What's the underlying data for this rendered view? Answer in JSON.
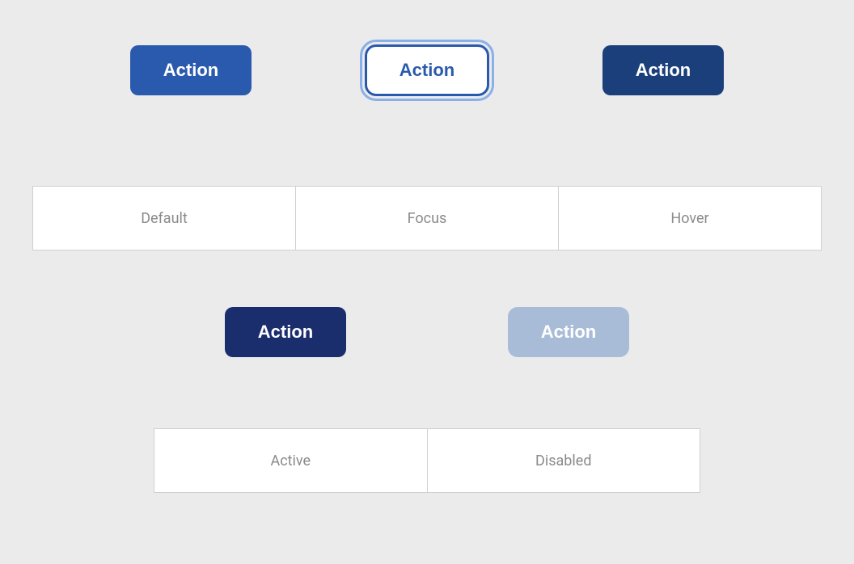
{
  "buttons": {
    "default": {
      "label": "Action",
      "state": "default"
    },
    "focus": {
      "label": "Action",
      "state": "focus"
    },
    "hover": {
      "label": "Action",
      "state": "hover"
    },
    "active": {
      "label": "Action",
      "state": "active"
    },
    "disabled": {
      "label": "Action",
      "state": "disabled"
    }
  },
  "labels": {
    "row1": [
      "Default",
      "Focus",
      "Hover"
    ],
    "row2": [
      "Active",
      "Disabled"
    ]
  },
  "colors": {
    "default_bg": "#2a5aad",
    "hover_bg": "#1a3f7a",
    "active_bg": "#1a2e6e",
    "disabled_bg": "#a8bcd8",
    "focus_bg": "#ffffff",
    "text_white": "#ffffff",
    "text_blue": "#2a5aad",
    "page_bg": "#ebebeb"
  }
}
